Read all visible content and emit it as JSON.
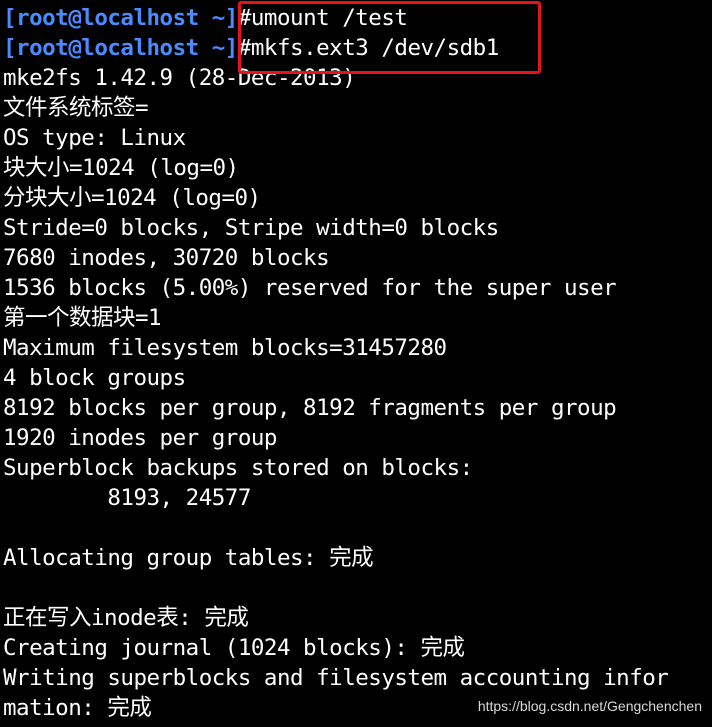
{
  "terminal": {
    "prompt": "[root@localhost ~]",
    "lines": [
      "#umount /test",
      "#mkfs.ext3 /dev/sdb1",
      "mke2fs 1.42.9 (28-Dec-2013)",
      "文件系统标签=",
      "OS type: Linux",
      "块大小=1024 (log=0)",
      "分块大小=1024 (log=0)",
      "Stride=0 blocks, Stripe width=0 blocks",
      "7680 inodes, 30720 blocks",
      "1536 blocks (5.00%) reserved for the super user",
      "第一个数据块=1",
      "Maximum filesystem blocks=31457280",
      "4 block groups",
      "8192 blocks per group, 8192 fragments per group",
      "1920 inodes per group",
      "Superblock backups stored on blocks:",
      "        8193, 24577",
      "",
      "Allocating group tables: 完成",
      "",
      "正在写入inode表: 完成",
      "Creating journal (1024 blocks): 完成",
      "Writing superblocks and filesystem accounting infor",
      "mation: 完成"
    ]
  },
  "watermark": "https://blog.csdn.net/Gengchenchen",
  "colors": {
    "background": "#000000",
    "text": "#ffffff",
    "prompt": "#4a8cff",
    "highlight": "#e8121a"
  }
}
